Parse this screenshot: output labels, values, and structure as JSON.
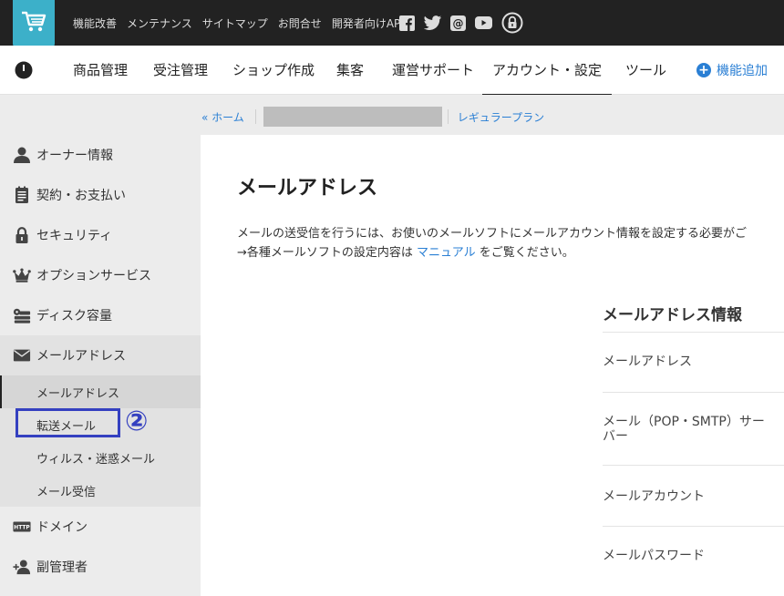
{
  "topbar": {
    "links": [
      "機能改善",
      "メンテナンス",
      "サイトマップ",
      "お問合せ",
      "開発者向けAPI"
    ],
    "social_icons": [
      "facebook-icon",
      "twitter-icon",
      "at-icon",
      "youtube-icon",
      "lock-icon"
    ]
  },
  "nav": {
    "items": [
      "商品管理",
      "受注管理",
      "ショップ作成",
      "集客",
      "運営サポート",
      "アカウント・設定",
      "ツール"
    ],
    "active": "アカウント・設定",
    "add_feature": "機能追加"
  },
  "breadcrumb": {
    "home": "« ホーム",
    "plan": "レギュラープラン"
  },
  "sidebar": {
    "items": [
      {
        "label": "オーナー情報",
        "icon": "person-icon"
      },
      {
        "label": "契約・お支払い",
        "icon": "document-icon"
      },
      {
        "label": "セキュリティ",
        "icon": "lock-icon"
      },
      {
        "label": "オプションサービス",
        "icon": "crown-icon"
      },
      {
        "label": "ディスク容量",
        "icon": "disk-icon"
      },
      {
        "label": "メールアドレス",
        "icon": "mail-icon"
      },
      {
        "label": "ドメイン",
        "icon": "http-icon"
      },
      {
        "label": "副管理者",
        "icon": "add-user-icon"
      }
    ],
    "submenu": [
      "メールアドレス",
      "転送メール",
      "ウィルス・迷惑メール",
      "メール受信"
    ]
  },
  "annotation": {
    "marker": "②"
  },
  "content": {
    "title": "メールアドレス",
    "desc_line1": "メールの送受信を行うには、お使いのメールソフトにメールアカウント情報を設定する必要がご",
    "desc_line2_pre": "→各種メールソフトの設定内容は ",
    "desc_link": "マニュアル",
    "desc_line2_post": " をご覧ください。",
    "info_heading": "メールアドレス情報",
    "info_rows": [
      "メールアドレス",
      "メール（POP・SMTP）サーバー",
      "メールアカウント",
      "メールパスワード"
    ]
  },
  "colors": {
    "topbar": "#222222",
    "cart_accent": "#3cb0c9",
    "link": "#2a7fd4",
    "annotation": "#3440c0"
  }
}
